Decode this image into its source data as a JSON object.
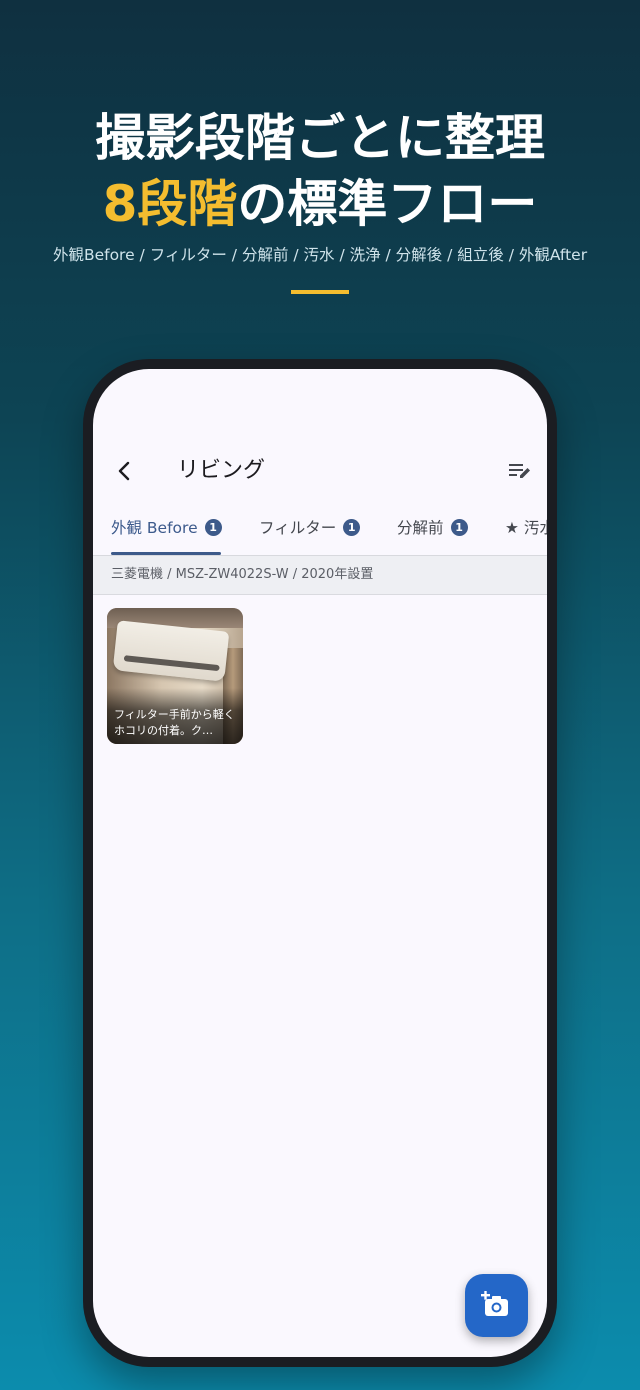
{
  "promo": {
    "headline_line1": "撮影段階ごとに整理",
    "headline_line2_accent": "8段階",
    "headline_line2_rest": "の標準フロー",
    "stages_line": "外観Before / フィルター / 分解前 / 汚水 / 洗浄 / 分解後 / 組立後 / 外観After"
  },
  "colors": {
    "accent": "#f4bd2f",
    "primary": "#3d5a8a",
    "fab": "#2467c8"
  },
  "appbar": {
    "back_icon": "chevron-left-icon",
    "title": "リビング",
    "action_icon": "edit-list-icon"
  },
  "tabs": [
    {
      "label": "外観 Before",
      "count": "1",
      "active": true
    },
    {
      "label": "フィルター",
      "count": "1",
      "active": false
    },
    {
      "label": "分解前",
      "count": "1",
      "active": false
    },
    {
      "label": "★ 汚水",
      "count": "",
      "active": false
    }
  ],
  "device_info": "三菱電機 / MSZ-ZW4022S-W / 2020年設置",
  "photos": [
    {
      "caption": "フィルター手前から軽くホコリの付着。ク…"
    }
  ],
  "fab": {
    "icon": "add-photo-camera-icon"
  }
}
